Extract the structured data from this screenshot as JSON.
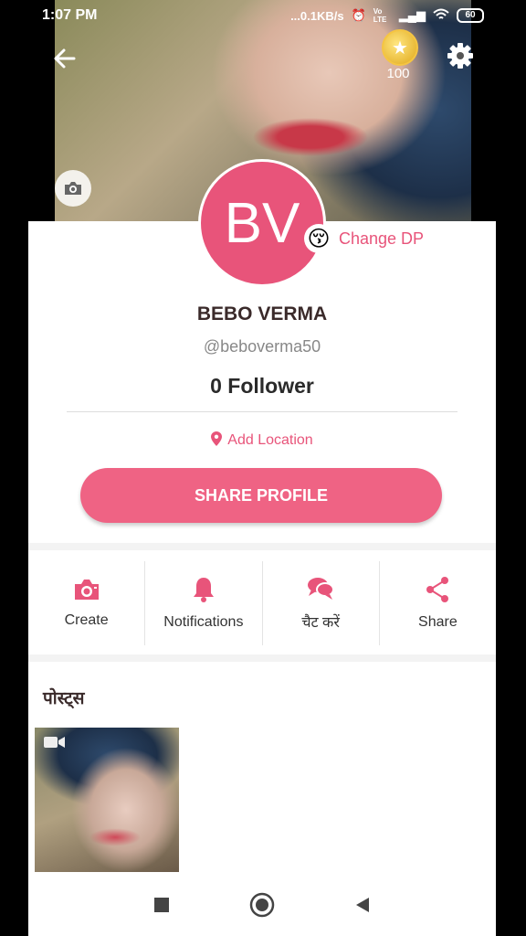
{
  "status_bar": {
    "time": "1:07 PM",
    "network_speed": "...0.1KB/s",
    "volte": "Vo LTE",
    "battery": "60"
  },
  "cover": {
    "coins": "100"
  },
  "profile": {
    "initials": "BV",
    "change_dp_label": "Change DP",
    "change_dp_emoji": "😚",
    "name": "BEBO VERMA",
    "handle": "@beboverma50",
    "followers": "0 Follower",
    "add_location": "Add Location",
    "share_profile": "SHARE PROFILE"
  },
  "actions": [
    {
      "label": "Create",
      "icon": "camera-icon"
    },
    {
      "label": "Notifications",
      "icon": "bell-icon"
    },
    {
      "label": "चैट करें",
      "icon": "chat-icon"
    },
    {
      "label": "Share",
      "icon": "share-icon"
    }
  ],
  "posts": {
    "title": "पोस्ट्स"
  },
  "colors": {
    "accent": "#ef6384",
    "avatar": "#e8547a"
  }
}
